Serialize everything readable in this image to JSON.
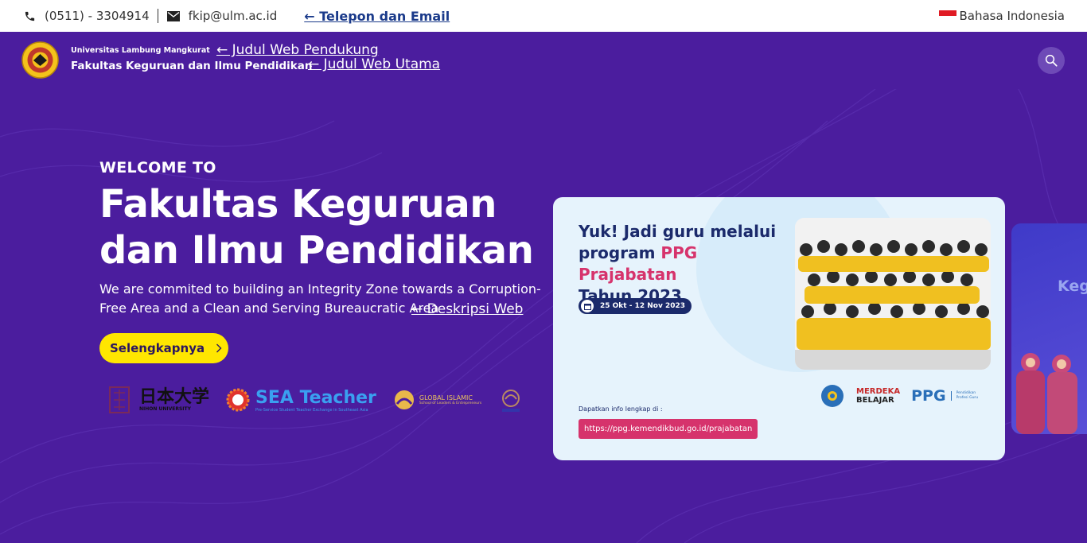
{
  "topbar": {
    "phone": "(0511) - 3304914",
    "email": "fkip@ulm.ac.id",
    "annotation": "← Telepon dan Email",
    "language": "Bahasa Indonesia"
  },
  "header": {
    "university": "Universitas Lambung Mangkurat",
    "faculty": "Fakultas Keguruan dan Ilmu Pendidikan",
    "annotation_support": "← Judul Web Pendukung",
    "annotation_main": "← Judul Web Utama"
  },
  "hero": {
    "welcome": "WELCOME TO",
    "title_line1": "Fakultas Keguruan",
    "title_line2": "dan Ilmu Pendidikan",
    "description": "We are commited to building an Integrity Zone towards a Corruption-Free Area and a Clean and Serving Bureaucratic Area",
    "annotation_desc": "← Deskripsi Web",
    "cta_label": "Selengkapnya"
  },
  "partners": [
    {
      "name": "日本大学",
      "sub": "NIHON UNIVERSITY"
    },
    {
      "name": "SEA Teacher",
      "sub": "Pre-Service Student Teacher Exchange in Southeast Asia"
    },
    {
      "name": "GLOBAL ISLAMIC",
      "sub": "School of Leaders & Entrepreneurs"
    }
  ],
  "slide": {
    "headline_part1": "Yuk! Jadi guru melalui program ",
    "headline_highlight": "PPG Prajabatan",
    "headline_part2": "Tahun 2023",
    "date": "25 Okt - 12 Nov 2023",
    "info_label": "Dapatkan info lengkap di :",
    "url": "https://ppg.kemendikbud.go.id/prajabatan",
    "merdeka_1": "MERDEKA",
    "merdeka_2": "BELAJAR",
    "ppg": "PPG",
    "ppg_sub": "Pendidikan Profesi Guru"
  },
  "next_slide": {
    "text": "Keg"
  },
  "colors": {
    "background": "#4b1d9e",
    "cta": "#ffe600",
    "highlight": "#d6336c",
    "navy": "#1b2a6b"
  }
}
